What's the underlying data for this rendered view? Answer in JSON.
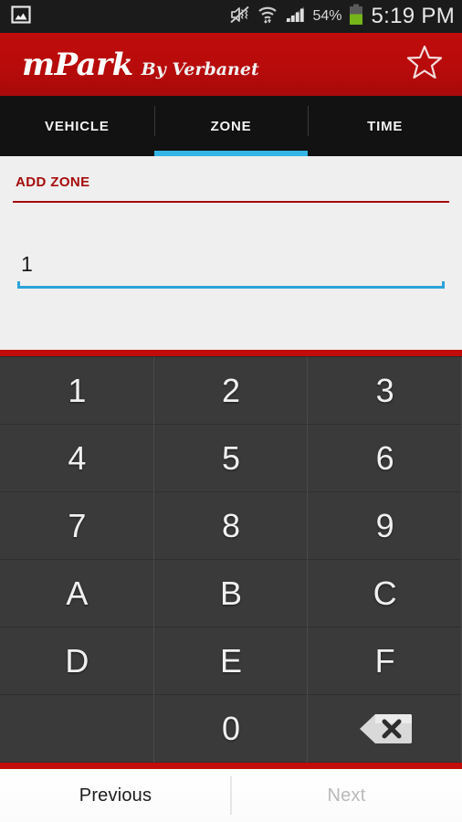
{
  "statusbar": {
    "notification_icon": "gallery-image-icon",
    "icons": [
      "mute-vibrate-icon",
      "wifi-icon",
      "signal-bars-icon"
    ],
    "battery_percent": "54%",
    "battery_level": 54,
    "time": "5:19 PM",
    "background": "#1b1b1b"
  },
  "appbar": {
    "brand_main": "mPark",
    "brand_sub": "By Verbanet",
    "favorite_icon": "star-outline-icon",
    "background": "#be0c0c"
  },
  "tabs": {
    "items": [
      {
        "label": "VEHICLE",
        "active": false
      },
      {
        "label": "ZONE",
        "active": true
      },
      {
        "label": "TIME",
        "active": false
      }
    ],
    "active_index": 1,
    "indicator_color": "#33b5e5",
    "background": "#121212"
  },
  "content": {
    "section_title": "ADD ZONE",
    "rule_color": "#a60b0b",
    "background": "#efefef",
    "zone_field": {
      "value": "1",
      "placeholder": "",
      "underline_color": "#2aa3d8"
    }
  },
  "keypad": {
    "accent_bar_color": "#c20b0b",
    "background": "#3a3a3a",
    "keys": [
      {
        "label": "1",
        "type": "digit"
      },
      {
        "label": "2",
        "type": "digit"
      },
      {
        "label": "3",
        "type": "digit"
      },
      {
        "label": "4",
        "type": "digit"
      },
      {
        "label": "5",
        "type": "digit"
      },
      {
        "label": "6",
        "type": "digit"
      },
      {
        "label": "7",
        "type": "digit"
      },
      {
        "label": "8",
        "type": "digit"
      },
      {
        "label": "9",
        "type": "digit"
      },
      {
        "label": "A",
        "type": "letter"
      },
      {
        "label": "B",
        "type": "letter"
      },
      {
        "label": "C",
        "type": "letter"
      },
      {
        "label": "D",
        "type": "letter"
      },
      {
        "label": "E",
        "type": "letter"
      },
      {
        "label": "F",
        "type": "letter"
      },
      {
        "label": "",
        "type": "blank"
      },
      {
        "label": "0",
        "type": "digit"
      },
      {
        "label": "",
        "type": "backspace",
        "icon": "backspace-icon"
      }
    ]
  },
  "bottomnav": {
    "previous_label": "Previous",
    "next_label": "Next",
    "previous_enabled": true,
    "next_enabled": false,
    "background": "#ffffff"
  }
}
